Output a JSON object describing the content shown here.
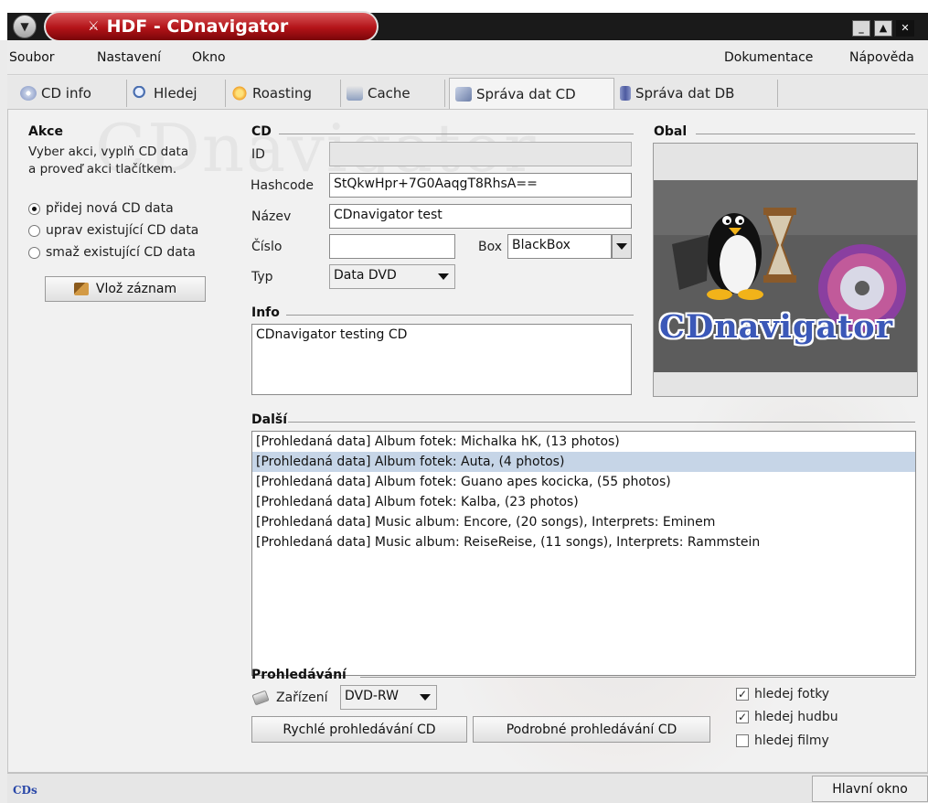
{
  "window": {
    "title": "HDF - CDnavigator",
    "controls": [
      "minimize",
      "maximize",
      "close"
    ]
  },
  "menubar": {
    "left": [
      "Soubor",
      "Nastavení",
      "Okno"
    ],
    "right": [
      "Dokumentace",
      "Nápověda"
    ]
  },
  "tabs": [
    {
      "label": "CD info",
      "icon": "cd-icon",
      "active": false
    },
    {
      "label": "Hledej",
      "icon": "magnifier-icon",
      "active": false
    },
    {
      "label": "Roasting",
      "icon": "flame-icon",
      "active": false
    },
    {
      "label": "Cache",
      "icon": "cache-icon",
      "active": false
    },
    {
      "label": "Správa dat CD",
      "icon": "cd-tools-icon",
      "active": true
    },
    {
      "label": "Správa dat DB",
      "icon": "database-icon",
      "active": false
    }
  ],
  "akce": {
    "title": "Akce",
    "description_line1": "Vyber akci, vyplň CD data",
    "description_line2": "a proveď akci tlačítkem.",
    "options": [
      {
        "label": "přidej nová CD data",
        "selected": true
      },
      {
        "label": "uprav existující CD data",
        "selected": false
      },
      {
        "label": "smaž existující CD data",
        "selected": false
      }
    ],
    "action_button": "Vlož záznam"
  },
  "cd": {
    "title": "CD",
    "id_label": "ID",
    "id_value": "",
    "hashcode_label": "Hashcode",
    "hashcode_value": "StQkwHpr+7G0AaqgT8RhsA==",
    "nazev_label": "Název",
    "nazev_value": "CDnavigator test",
    "cislo_label": "Číslo",
    "cislo_value": "",
    "box_label": "Box",
    "box_value": "BlackBox",
    "typ_label": "Typ",
    "typ_value": "Data DVD"
  },
  "info": {
    "title": "Info",
    "value": "CDnavigator testing CD"
  },
  "obal": {
    "title": "Obal",
    "logo_text": "CDnavigator"
  },
  "dalsi": {
    "title": "Další",
    "items": [
      "[Prohledaná data] Album fotek: Michalka hK,  (13 photos)",
      "[Prohledaná data] Album fotek: Auta,  (4 photos)",
      "[Prohledaná data] Album fotek: Guano apes kocicka,  (55 photos)",
      "[Prohledaná data] Album fotek: Kalba,  (23 photos)",
      "[Prohledaná data] Music album: Encore,  (20 songs),  Interprets: Eminem",
      "[Prohledaná data] Music album: ReiseReise,  (11 songs),  Interprets: Rammstein"
    ],
    "selected_index": 1
  },
  "prohledavani": {
    "title": "Prohledávání",
    "device_label": "Zařízení",
    "device_value": "DVD-RW",
    "quick_button": "Rychlé prohledávání CD",
    "detailed_button": "Podrobné prohledávání CD",
    "checks": [
      {
        "label": "hledej fotky",
        "checked": true
      },
      {
        "label": "hledej hudbu",
        "checked": true
      },
      {
        "label": "hledej filmy",
        "checked": false
      }
    ]
  },
  "statusbar": {
    "logo": "CDs",
    "main_window_button": "Hlavní okno"
  },
  "colors": {
    "title_pill": "#b31318",
    "selection": "#c6d5e7",
    "logo_blue": "#3b58b8"
  }
}
